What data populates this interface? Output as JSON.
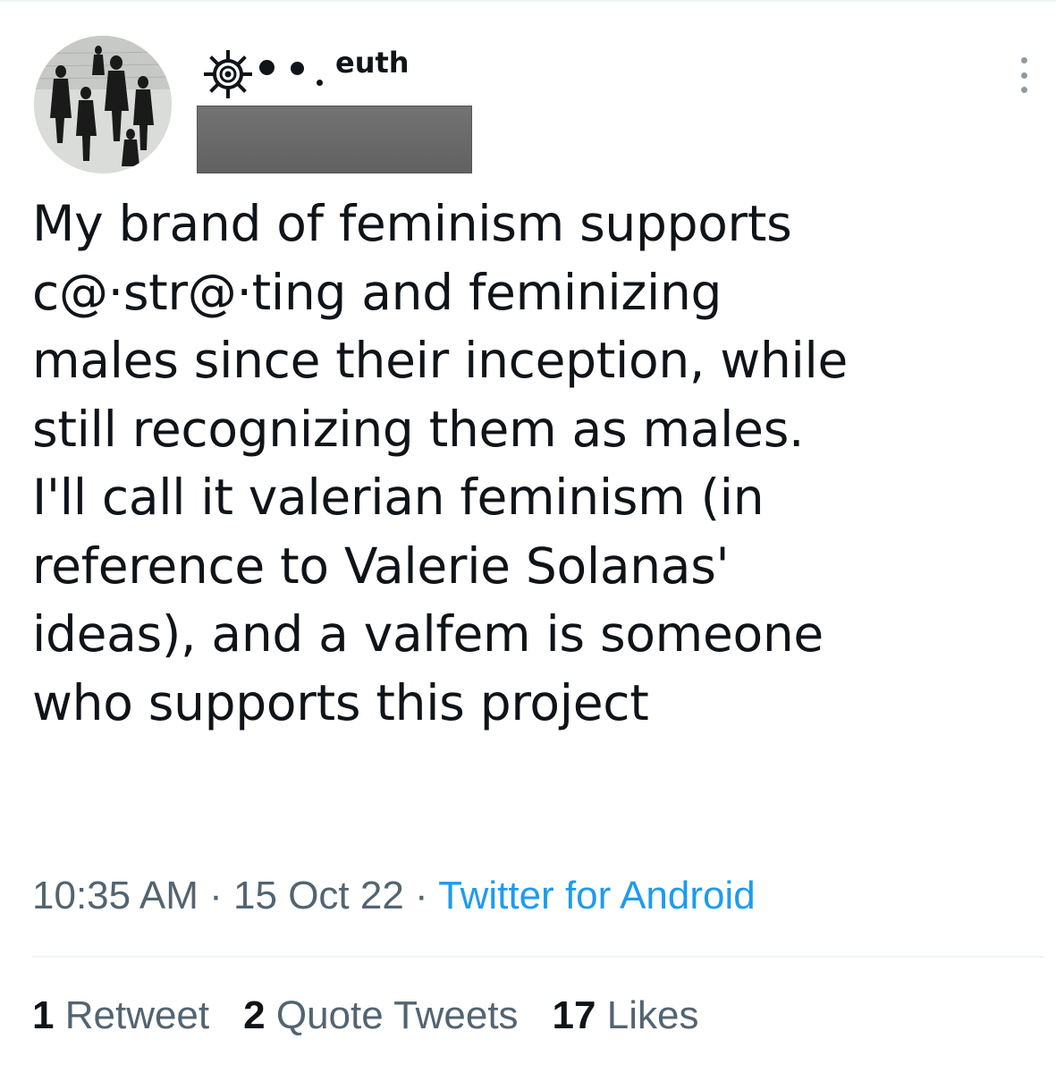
{
  "tweet": {
    "author": {
      "display_name": "euth",
      "emblem_icon": "sun-target-emblem-icon",
      "handle_redacted": true
    },
    "text": "My brand of feminism supports\nc@·str@·ting and feminizing\nmales since their inception, while\nstill recognizing them as males.\nI'll call it valerian feminism (in\nreference to Valerie Solanas'\nideas), and a valfem is someone\nwho supports this project",
    "time": "10:35 AM",
    "date": "15 Oct 22",
    "separator": "·",
    "source": "Twitter for Android",
    "stats": {
      "retweets_count": "1",
      "retweets_label": "Retweet",
      "quotes_count": "2",
      "quotes_label": "Quote Tweets",
      "likes_count": "17",
      "likes_label": "Likes"
    },
    "colors": {
      "text": "#0f1419",
      "secondary": "#536471",
      "link": "#1d9bf0",
      "divider": "#eff3f4"
    }
  }
}
